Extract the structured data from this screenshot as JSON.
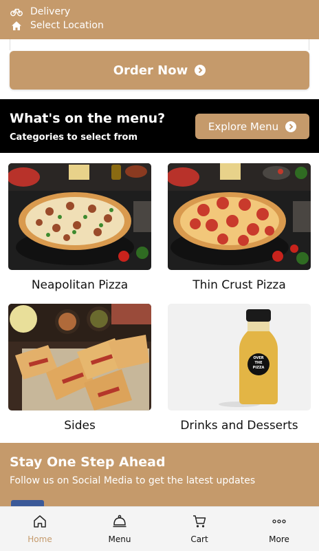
{
  "header": {
    "delivery_label": "Delivery",
    "location_label": "Select Location"
  },
  "order": {
    "button_label": "Order Now"
  },
  "menu_section": {
    "title": "What's on the menu?",
    "subtitle": "Categories to select from",
    "explore_label": "Explore Menu"
  },
  "categories": [
    {
      "label": "Neapolitan Pizza",
      "image": "neapolitan-pizza-photo"
    },
    {
      "label": "Thin Crust Pizza",
      "image": "thin-crust-pizza-photo"
    },
    {
      "label": "Sides",
      "image": "calzone-sides-photo"
    },
    {
      "label": "Drinks and Desserts",
      "image": "juice-bottle-photo"
    }
  ],
  "social": {
    "title": "Stay One Step Ahead",
    "subtitle": "Follow us on Social Media to get the latest updates",
    "facebook_icon": "facebook-icon"
  },
  "bottom_nav": {
    "active_index": 0,
    "items": [
      {
        "label": "Home",
        "icon": "home-icon"
      },
      {
        "label": "Menu",
        "icon": "cloche-icon"
      },
      {
        "label": "Cart",
        "icon": "cart-icon"
      },
      {
        "label": "More",
        "icon": "more-dots-icon"
      }
    ]
  },
  "colors": {
    "accent": "#c59a6b",
    "band_dark": "#000000",
    "facebook": "#3b5998"
  },
  "bottle_label": {
    "line1": "OVER",
    "line2": "THE",
    "line3": "PIZZA"
  }
}
